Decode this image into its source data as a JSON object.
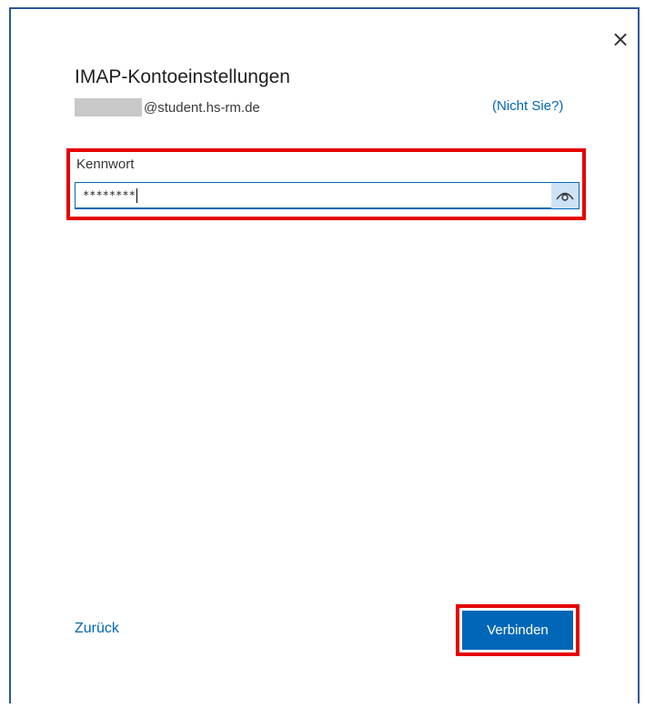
{
  "dialog": {
    "title": "IMAP-Kontoeinstellungen",
    "close_glyph": "×",
    "account_domain": "@student.hs-rm.de",
    "not_you_label": "(Nicht Sie?)"
  },
  "password": {
    "label": "Kennwort",
    "masked_value": "********",
    "reveal_icon": "eye-icon"
  },
  "footer": {
    "back_label": "Zurück",
    "connect_label": "Verbinden"
  },
  "colors": {
    "accent": "#0067b8",
    "highlight": "#e50000",
    "window_border": "#2b5797"
  }
}
